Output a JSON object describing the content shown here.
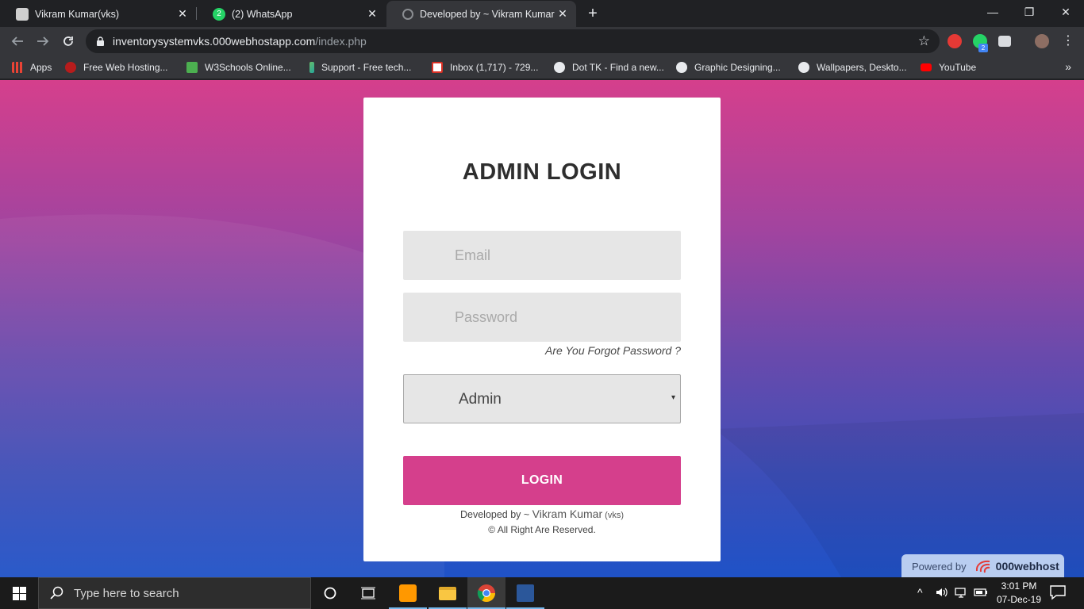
{
  "browser": {
    "tabs": [
      {
        "title": "Vikram Kumar(vks)",
        "close": "✕",
        "active": false
      },
      {
        "title": "(2) WhatsApp",
        "close": "✕",
        "active": false,
        "favicon_badge": "2"
      },
      {
        "title": "Developed by ~ Vikram Kumar (vks)",
        "close": "✕",
        "active": true
      }
    ],
    "new_tab": "+",
    "window_controls": {
      "minimize": "—",
      "restore": "❐",
      "close": "✕"
    },
    "url": {
      "host": "inventorysystemvks.000webhostapp.com",
      "path": "/index.php"
    },
    "extension_badge": "2",
    "bookmarks": [
      {
        "label": "Apps",
        "icon": "apps-grid-icon"
      },
      {
        "label": "Free Web Hosting...",
        "icon": "webhost-icon"
      },
      {
        "label": "W3Schools Online...",
        "icon": "w3schools-icon"
      },
      {
        "label": "Support - Free tech...",
        "icon": "support-icon"
      },
      {
        "label": "Inbox (1,717) - 729...",
        "icon": "gmail-icon"
      },
      {
        "label": "Dot TK - Find a new...",
        "icon": "globe-icon"
      },
      {
        "label": "Graphic Designing...",
        "icon": "globe-icon"
      },
      {
        "label": "Wallpapers, Deskto...",
        "icon": "globe-icon"
      },
      {
        "label": "YouTube",
        "icon": "youtube-icon"
      }
    ],
    "bookmarks_more": "»"
  },
  "login": {
    "title": "ADMIN LOGIN",
    "email_placeholder": "Email",
    "password_placeholder": "Password",
    "forgot": "Are You Forgot Password ?",
    "role_selected": "Admin",
    "role_caret": "▾",
    "button": "LOGIN",
    "dev_prefix": "Developed by ~ ",
    "dev_name": "Vikram Kumar",
    "dev_suffix": " (vks)",
    "rights": "© All Right Are Reserved."
  },
  "powered": {
    "prefix": "Powered by",
    "brand": "000webhost"
  },
  "taskbar": {
    "search_placeholder": "Type here to search",
    "time": "3:01 PM",
    "date": "07-Dec-19"
  },
  "colors": {
    "accent": "#d53f8c",
    "bg_top": "#d53f8c",
    "bg_bottom": "#1f52c7"
  }
}
